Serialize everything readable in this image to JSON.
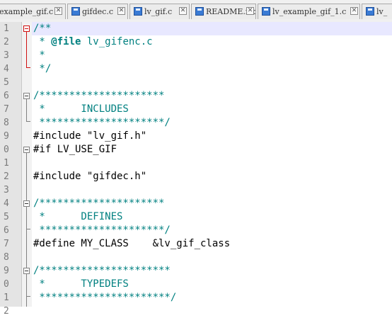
{
  "tabs": [
    {
      "label": "example_gif.c",
      "has_save_icon": false
    },
    {
      "label": "gifdec.c",
      "has_save_icon": true
    },
    {
      "label": "lv_gif.c",
      "has_save_icon": true
    },
    {
      "label": "README.md",
      "has_save_icon": true
    },
    {
      "label": "lv_example_gif_1.c",
      "has_save_icon": true
    },
    {
      "label": "lv_",
      "has_save_icon": true
    }
  ],
  "close_glyph": "✕",
  "editor": {
    "current_line_color": "#e8e8ff",
    "lines": [
      {
        "num": "1",
        "parts": [
          {
            "t": "/**",
            "c": "c-com"
          }
        ]
      },
      {
        "num": "2",
        "parts": [
          {
            "t": " * ",
            "c": "c-com"
          },
          {
            "t": "@file",
            "c": "c-tag"
          },
          {
            "t": " lv_gifenc.c",
            "c": "c-com"
          }
        ]
      },
      {
        "num": "3",
        "parts": [
          {
            "t": " *",
            "c": "c-com"
          }
        ]
      },
      {
        "num": "4",
        "parts": [
          {
            "t": " */",
            "c": "c-com"
          }
        ]
      },
      {
        "num": "5",
        "parts": []
      },
      {
        "num": "6",
        "parts": [
          {
            "t": "/*********************",
            "c": "c-com"
          }
        ]
      },
      {
        "num": "7",
        "parts": [
          {
            "t": " *      INCLUDES",
            "c": "c-com"
          }
        ]
      },
      {
        "num": "8",
        "parts": [
          {
            "t": " *********************/",
            "c": "c-com"
          }
        ]
      },
      {
        "num": "9",
        "parts": [
          {
            "t": "#include \"lv_gif.h\"",
            "c": "c-pre"
          }
        ]
      },
      {
        "num": "0",
        "parts": [
          {
            "t": "#if LV_USE_GIF",
            "c": "c-pre"
          }
        ]
      },
      {
        "num": "1",
        "parts": []
      },
      {
        "num": "2",
        "parts": [
          {
            "t": "#include \"gifdec.h\"",
            "c": "c-pre"
          }
        ]
      },
      {
        "num": "3",
        "parts": []
      },
      {
        "num": "4",
        "parts": [
          {
            "t": "/*********************",
            "c": "c-com"
          }
        ]
      },
      {
        "num": "5",
        "parts": [
          {
            "t": " *      DEFINES",
            "c": "c-com"
          }
        ]
      },
      {
        "num": "6",
        "parts": [
          {
            "t": " *********************/",
            "c": "c-com"
          }
        ]
      },
      {
        "num": "7",
        "parts": [
          {
            "t": "#define MY_CLASS    &lv_gif_class",
            "c": "c-pre"
          }
        ]
      },
      {
        "num": "8",
        "parts": []
      },
      {
        "num": "9",
        "parts": [
          {
            "t": "/**********************",
            "c": "c-com"
          }
        ]
      },
      {
        "num": "0",
        "parts": [
          {
            "t": " *      TYPEDEFS",
            "c": "c-com"
          }
        ]
      },
      {
        "num": "1",
        "parts": [
          {
            "t": " **********************/",
            "c": "c-com"
          }
        ]
      },
      {
        "num": "2",
        "parts": []
      }
    ]
  }
}
